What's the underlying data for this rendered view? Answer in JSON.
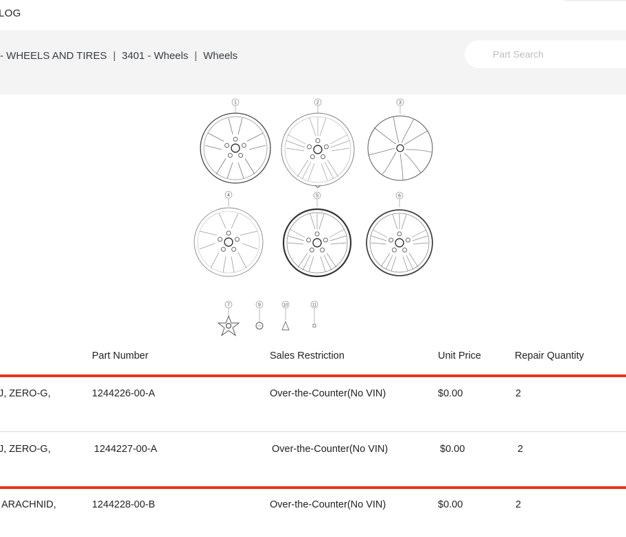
{
  "header": {
    "title": "LOG"
  },
  "breadcrumb": [
    "- WHEELS AND TIRES",
    "3401 - Wheels",
    "Wheels"
  ],
  "search": {
    "placeholder": "Part Search"
  },
  "diagram": {
    "callouts": [
      "1",
      "2",
      "3",
      "4",
      "5",
      "6",
      "7",
      "9",
      "10",
      "11"
    ]
  },
  "table": {
    "headers": [
      "Part Number",
      "Sales Restriction",
      "Unit Price",
      "Repair Quantity"
    ],
    "rows": [
      {
        "name": "J, ZERO-G,",
        "part_number": "1244226-00-A",
        "restriction": "Over-the-Counter(No VIN)",
        "price": "$0.00",
        "qty": "2"
      },
      {
        "name": "J, ZERO-G,",
        "part_number": "1244227-00-A",
        "restriction": "Over-the-Counter(No VIN)",
        "price": "$0.00",
        "qty": "2"
      },
      {
        "name": "ARACHNID,",
        "part_number": "1244228-00-B",
        "restriction": "Over-the-Counter(No VIN)",
        "price": "$0.00",
        "qty": "2"
      }
    ]
  },
  "colors": {
    "highlight": "#e8321c",
    "breadcrumb_bg": "#f4f4f4"
  }
}
